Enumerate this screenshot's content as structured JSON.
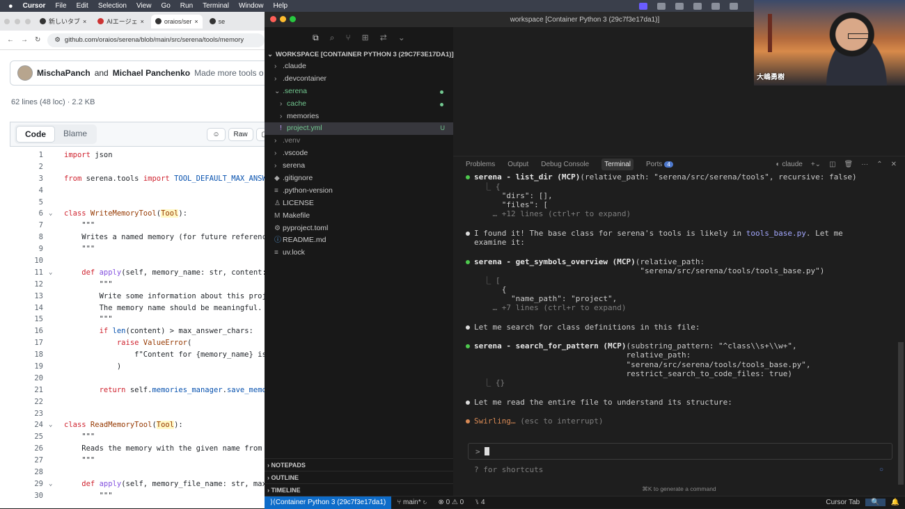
{
  "menubar": {
    "app": "Cursor",
    "items": [
      "File",
      "Edit",
      "Selection",
      "View",
      "Go",
      "Run",
      "Terminal",
      "Window",
      "Help"
    ]
  },
  "browser": {
    "tabs": [
      "新しいタブ",
      "AIエージェ",
      "oraios/ser",
      "se"
    ],
    "url": "github.com/oraios/serena/blob/main/src/serena/tools/memory",
    "commit": {
      "author1": "MischaPanch",
      "and": "and",
      "author2": "Michael Panchenko",
      "message": "Made more tools o"
    },
    "line_info": "62 lines (48 loc) · 2.2 KB",
    "view_tabs": [
      "Code",
      "Blame"
    ],
    "raw_label": "Raw",
    "code_lines": [
      {
        "n": "1"
      },
      {
        "n": "2"
      },
      {
        "n": "3"
      },
      {
        "n": "4"
      },
      {
        "n": "5"
      },
      {
        "n": "6"
      },
      {
        "n": "7"
      },
      {
        "n": "8"
      },
      {
        "n": "9"
      },
      {
        "n": "10"
      },
      {
        "n": "11"
      },
      {
        "n": "12"
      },
      {
        "n": "13"
      },
      {
        "n": "14"
      },
      {
        "n": "15"
      },
      {
        "n": "16"
      },
      {
        "n": "17"
      },
      {
        "n": "18"
      },
      {
        "n": "19"
      },
      {
        "n": "20"
      },
      {
        "n": "21"
      },
      {
        "n": "22"
      },
      {
        "n": "23"
      },
      {
        "n": "24"
      },
      {
        "n": "25"
      },
      {
        "n": "26"
      },
      {
        "n": "27"
      },
      {
        "n": "28"
      },
      {
        "n": "29"
      },
      {
        "n": "30"
      }
    ],
    "code_text": {
      "l1_kw": "import",
      "l1_rest": " json",
      "l3_kw1": "from",
      "l3_mid": " serena.tools ",
      "l3_kw2": "import",
      "l3_rest": " TOOL_DEFAULT_MAX_ANSWE",
      "l6_kw": "class",
      "l6_cls": " WriteMemoryTool",
      "l6_p1": "(",
      "l6_base": "Tool",
      "l6_p2": "):",
      "l7": "    \"\"\"",
      "l8": "    Writes a named memory (for future reference",
      "l9": "    \"\"\"",
      "l11_kw": "    def",
      "l11_fn": " apply",
      "l11_rest": "(self, memory_name: str, content: ",
      "l12": "        \"\"\"",
      "l13": "        Write some information about this proje",
      "l14": "        The memory name should be meaningful.",
      "l15": "        \"\"\"",
      "l16_kw": "        if",
      "l16_bi": " len",
      "l16_rest": "(content) > max_answer_chars:",
      "l17_kw": "            raise",
      "l17_cls": " ValueError",
      "l17_rest": "(",
      "l18": "                f\"Content for {memory_name} is ",
      "l19": "            )",
      "l21_kw": "        return",
      "l21_a": " self.",
      "l21_b": "memories_manager",
      "l21_c": ".",
      "l21_d": "save_memor",
      "l24_kw": "class",
      "l24_cls": " ReadMemoryTool",
      "l24_p1": "(",
      "l24_base": "Tool",
      "l24_p2": "):",
      "l25": "    \"\"\"",
      "l26": "    Reads the memory with the given name from S",
      "l27": "    \"\"\"",
      "l29_kw": "    def",
      "l29_fn": " apply",
      "l29_rest": "(self, memory_file_name: str, max_",
      "l30": "        \"\"\""
    }
  },
  "vscode": {
    "title": "workspace [Container Python 3 (29c7f3e17da1)]",
    "workspace_header": "WORKSPACE [CONTAINER PYTHON 3 (29C7F3E17DA1)]",
    "tree": [
      {
        "name": ".claude"
      },
      {
        "name": ".devcontainer"
      },
      {
        "name": ".serena"
      },
      {
        "name": "cache"
      },
      {
        "name": "memories"
      },
      {
        "name": "project.yml",
        "badge": "U"
      },
      {
        "name": ".venv"
      },
      {
        "name": ".vscode"
      },
      {
        "name": "serena"
      },
      {
        "name": ".gitignore"
      },
      {
        "name": ".python-version"
      },
      {
        "name": "LICENSE"
      },
      {
        "name": "Makefile"
      },
      {
        "name": "pyproject.toml"
      },
      {
        "name": "README.md"
      },
      {
        "name": "uv.lock"
      }
    ],
    "sections": [
      "NOTEPADS",
      "OUTLINE",
      "TIMELINE"
    ],
    "panel_tabs": [
      "Problems",
      "Output",
      "Debug Console",
      "Terminal",
      "Ports"
    ],
    "ports_count": "4",
    "terminal_name": "claude",
    "terminal": {
      "t1_head": "serena - list_dir (MCP)",
      "t1_args": "(relative_path: \"serena/src/serena/tools\", recursive: false)",
      "t1_l2": "  ⎿ {",
      "t1_l3": "      \"dirs\": [],",
      "t1_l4": "      \"files\": [",
      "t1_l5": "    … +12 lines (ctrl+r to expand)",
      "t2_a": "I found it! The base class for serena's tools is likely in ",
      "t2_link": "tools_base.py",
      "t2_b": ". Let me",
      "t2_c": "examine it:",
      "t3_head": "serena - get_symbols_overview (MCP)",
      "t3_args": "(relative_path:",
      "t3_l2": "                                    \"serena/src/serena/tools/tools_base.py\")",
      "t3_l3": "  ⎿ [",
      "t3_l4": "      {",
      "t3_l5": "        \"name_path\": \"project\",",
      "t3_l6": "    … +7 lines (ctrl+r to expand)",
      "t4": "Let me search for class definitions in this file:",
      "t5_head": "serena - search_for_pattern (MCP)",
      "t5_args": "(substring_pattern: \"^class\\\\s+\\\\w+\",",
      "t5_l2": "                                 relative_path:",
      "t5_l3": "                                 \"serena/src/serena/tools/tools_base.py\",",
      "t5_l4": "                                 restrict_search_to_code_files: true)",
      "t5_l5": "  ⎿ {}",
      "t6": "Let me read the entire file to understand its structure:",
      "t7_a": "Swirling…",
      "t7_b": " (esc to interrupt)"
    },
    "prompt": ">",
    "shortcuts": "? for shortcuts",
    "gen_command": "⌘K to generate a command",
    "status": {
      "remote": "Container Python 3 (29c7f3e17da1)",
      "branch": "main*",
      "problems": "⊗ 0 ⚠ 0",
      "ports": "4",
      "cursor_tab": "Cursor Tab"
    }
  },
  "webcam": {
    "name": "大嶋勇樹"
  }
}
